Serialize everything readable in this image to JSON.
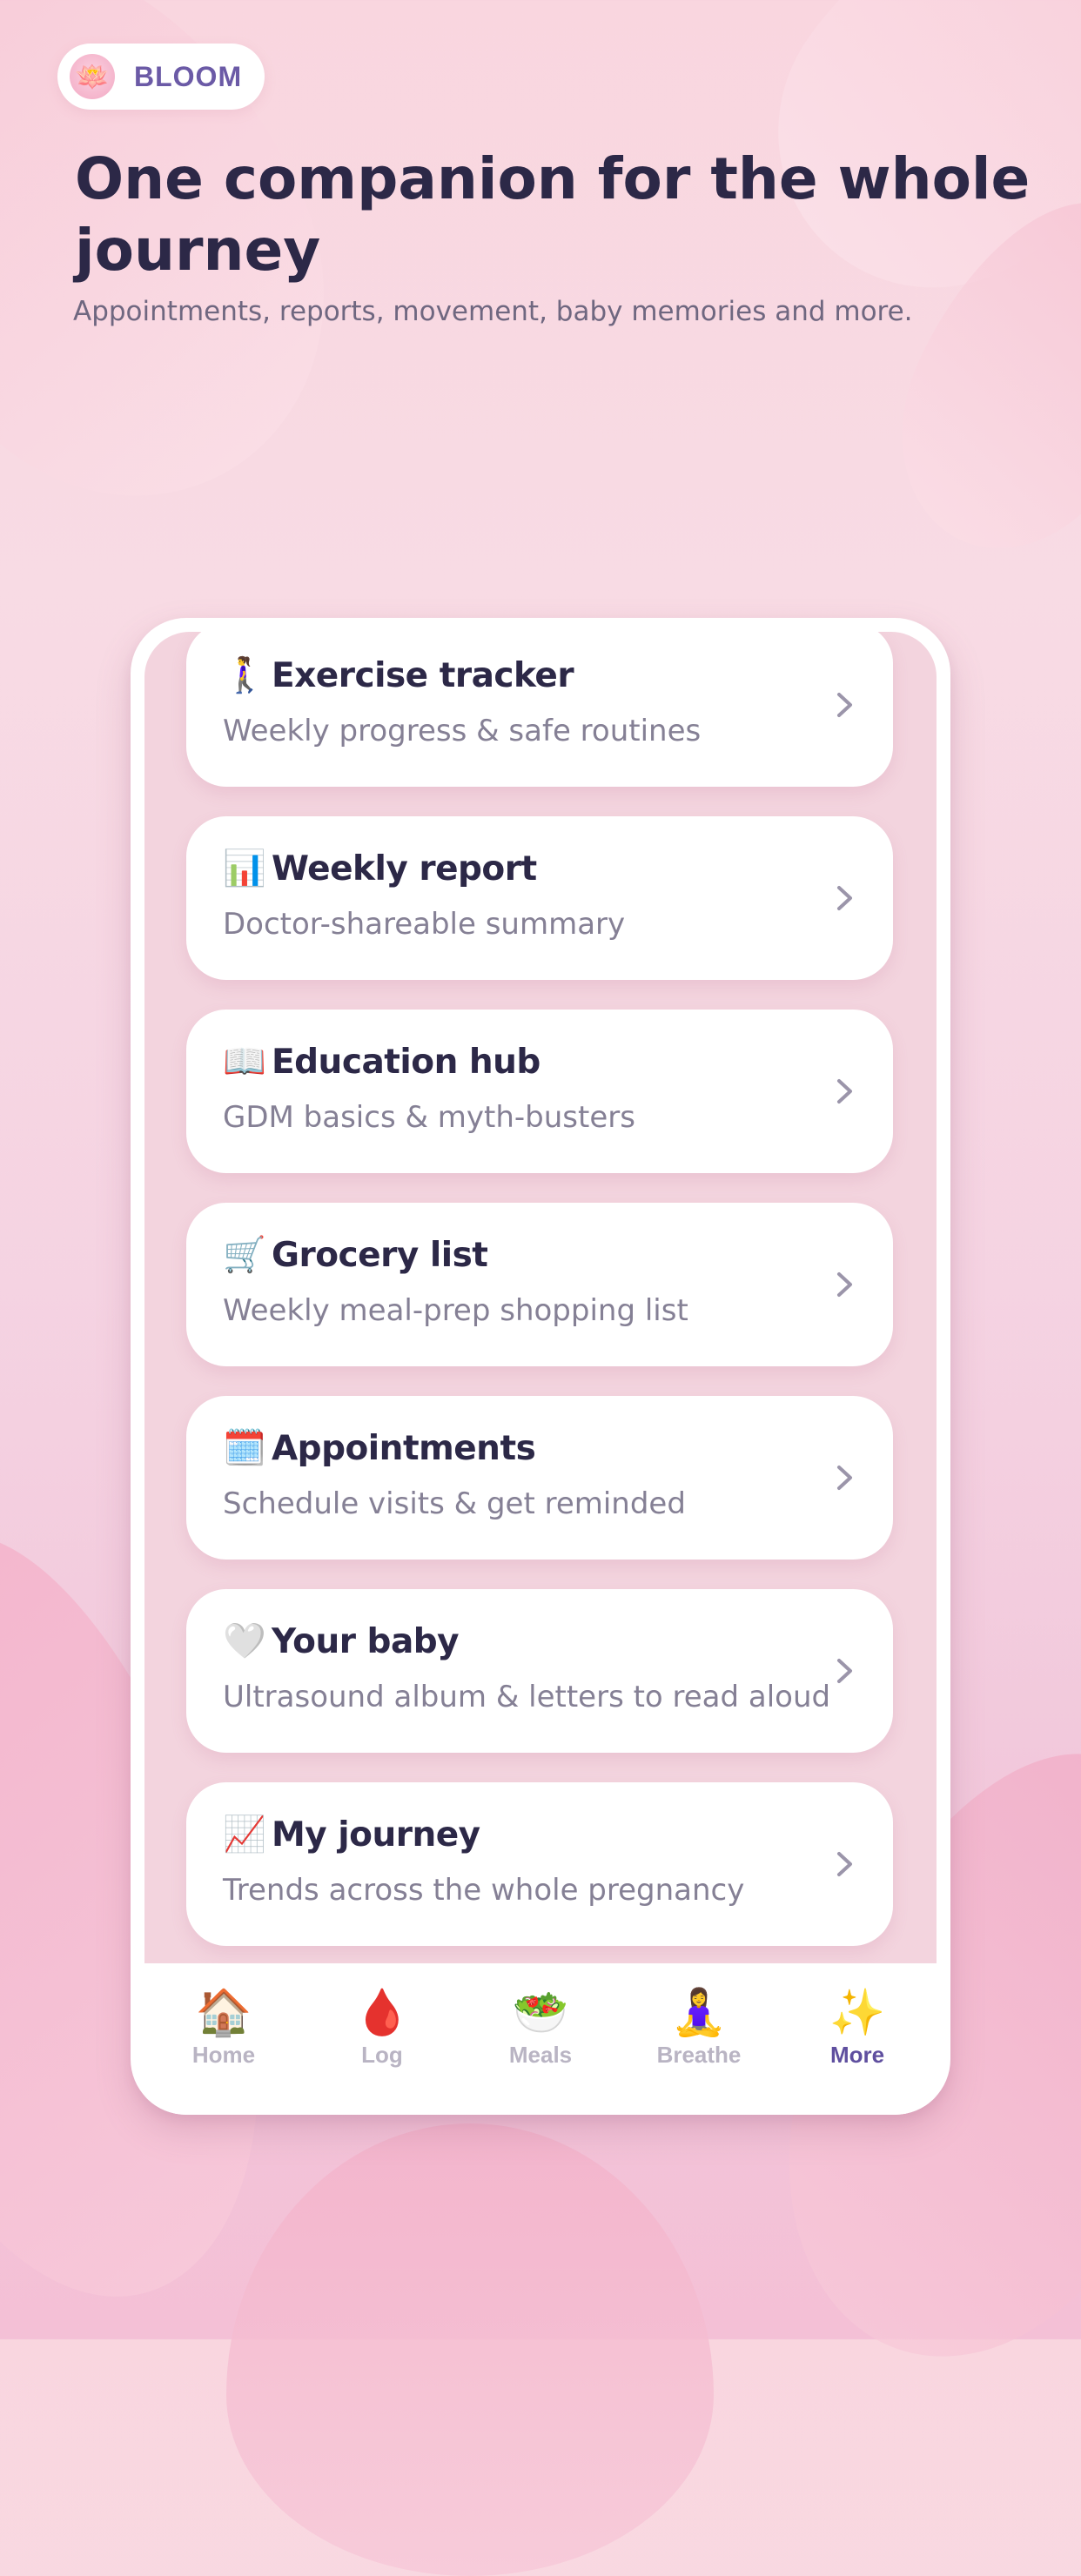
{
  "brand": {
    "name": "BLOOM",
    "logo_icon": "lotus-icon"
  },
  "hero": {
    "title": "One companion for the whole journey",
    "subtitle": "Appointments, reports, movement, baby memories and more."
  },
  "menu": {
    "items": [
      {
        "icon": "🚶‍♀️",
        "icon_name": "walking-person-icon",
        "title": "Exercise tracker",
        "subtitle": "Weekly progress & safe routines"
      },
      {
        "icon": "📊",
        "icon_name": "bar-chart-icon",
        "title": "Weekly report",
        "subtitle": "Doctor-shareable summary"
      },
      {
        "icon": "📖",
        "icon_name": "open-book-icon",
        "title": "Education hub",
        "subtitle": "GDM basics & myth-busters"
      },
      {
        "icon": "🛒",
        "icon_name": "shopping-cart-icon",
        "title": "Grocery list",
        "subtitle": "Weekly meal-prep shopping list"
      },
      {
        "icon": "🗓️",
        "icon_name": "calendar-icon",
        "title": "Appointments",
        "subtitle": "Schedule visits & get reminded"
      },
      {
        "icon": "🤍",
        "icon_name": "white-heart-icon",
        "title": "Your baby",
        "subtitle": "Ultrasound album & letters to read aloud"
      },
      {
        "icon": "📈",
        "icon_name": "trend-chart-icon",
        "title": "My journey",
        "subtitle": "Trends across the whole pregnancy"
      }
    ]
  },
  "tabs": [
    {
      "icon": "🏠",
      "icon_name": "home-icon",
      "label": "Home",
      "active": false
    },
    {
      "icon": "🩸",
      "icon_name": "drop-icon",
      "label": "Log",
      "active": false
    },
    {
      "icon": "🥗",
      "icon_name": "salad-icon",
      "label": "Meals",
      "active": false
    },
    {
      "icon": "🧘‍♀️",
      "icon_name": "meditation-icon",
      "label": "Breathe",
      "active": false
    },
    {
      "icon": "✨",
      "icon_name": "sparkles-icon",
      "label": "More",
      "active": true
    }
  ],
  "colors": {
    "title": "#2c2847",
    "accent": "#5f4f9f",
    "muted": "#858095",
    "background": "#f8dbe4"
  }
}
